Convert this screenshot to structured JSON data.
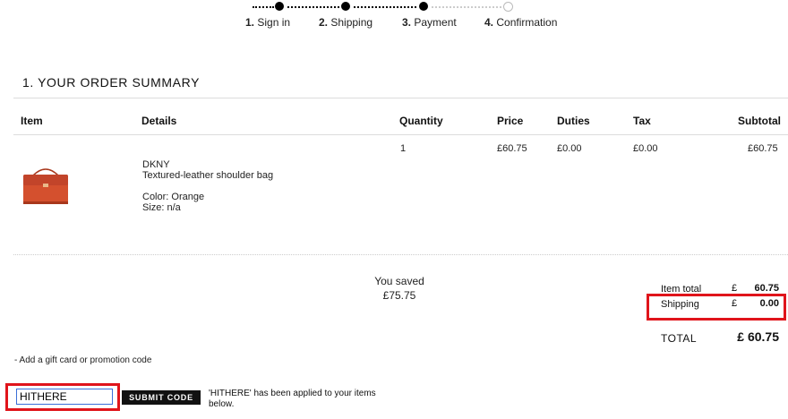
{
  "steps": [
    {
      "num": "1.",
      "label": "Sign in"
    },
    {
      "num": "2.",
      "label": "Shipping"
    },
    {
      "num": "3.",
      "label": "Payment"
    },
    {
      "num": "4.",
      "label": "Confirmation"
    }
  ],
  "section_title": "1. YOUR ORDER SUMMARY",
  "table": {
    "headers": [
      "Item",
      "Details",
      "Quantity",
      "Price",
      "Duties",
      "Tax",
      "Subtotal"
    ],
    "row": {
      "brand": "DKNY",
      "description": "Textured-leather shoulder bag",
      "color": "Color: Orange",
      "size": "Size: n/a",
      "quantity": "1",
      "price": "£60.75",
      "duties": "£0.00",
      "tax": "£0.00",
      "subtotal": "£60.75"
    }
  },
  "savings": {
    "label": "You saved",
    "amount": "£75.75"
  },
  "totals": {
    "item_total_label": "Item total",
    "item_total_currency": "£",
    "item_total_value": "60.75",
    "shipping_label": "Shipping",
    "shipping_currency": "£",
    "shipping_value": "0.00",
    "total_label": "TOTAL",
    "total_value": "£ 60.75"
  },
  "promo": {
    "link": "- Add a gift card or promotion code",
    "input_value": "HITHERE",
    "submit_label": "SUBMIT CODE",
    "message": "'HITHERE' has been applied to your items below."
  },
  "colors": {
    "highlight": "#e0141b",
    "bag": "#d4502e"
  }
}
